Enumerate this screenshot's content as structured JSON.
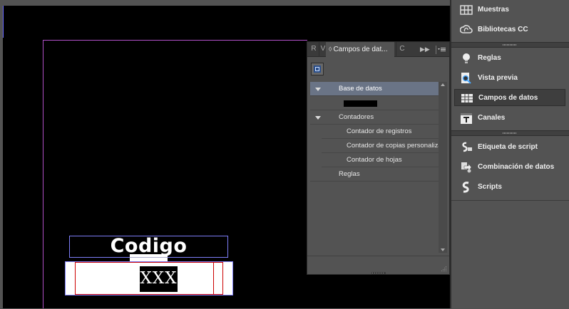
{
  "document": {
    "frame_title": "Codigo",
    "frame_placeholder": "XXX"
  },
  "data_fields_panel": {
    "tab_r": "R",
    "tab_v": "V",
    "tab_active": "Campos de dat...",
    "tab_c": "C",
    "tree": [
      {
        "label": "Base de datos",
        "expanded": true,
        "selected": true
      },
      {
        "label": "",
        "redacted": true
      },
      {
        "label": "Contadores",
        "expanded": true,
        "selected": false
      },
      {
        "label": "Contador de registros"
      },
      {
        "label": "Contador de copias personaliza"
      },
      {
        "label": "Contador de hojas"
      },
      {
        "label": "Reglas"
      }
    ]
  },
  "dock": {
    "items": [
      {
        "label": "Muestras",
        "icon": "swatches-icon"
      },
      {
        "label": "Bibliotecas CC",
        "icon": "cc-libraries-icon"
      },
      {
        "label": "Reglas",
        "icon": "rules-icon"
      },
      {
        "label": "Vista previa",
        "icon": "preview-icon"
      },
      {
        "label": "Campos de datos",
        "icon": "data-fields-icon",
        "active": true
      },
      {
        "label": "Canales",
        "icon": "channels-icon"
      },
      {
        "label": "Etiqueta de script",
        "icon": "script-label-icon"
      },
      {
        "label": "Combinación de datos",
        "icon": "data-merge-icon"
      },
      {
        "label": "Scripts",
        "icon": "scripts-icon"
      }
    ]
  },
  "colors": {
    "selection_row": "#6a7486",
    "page_margin": "#b150c8",
    "frame_outline": "#7e7ef8",
    "text_frame_red": "#cc0000"
  }
}
